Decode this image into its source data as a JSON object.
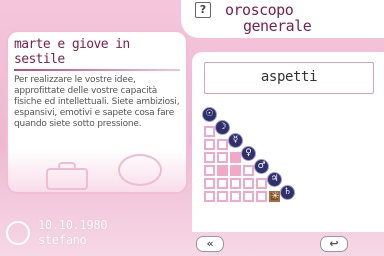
{
  "header": {
    "help_icon": "?",
    "title_line1": "oroscopo",
    "title_line2": "generale"
  },
  "reading": {
    "title": "marte e giove in sestile",
    "body": "Per realizzare le vostre idee, approfittate delle vostre capacità fisiche ed intellettuali. Siete ambiziosi, espansivi, emotivi e sapete cosa fare quando siete sotto pressione."
  },
  "user": {
    "date": "10.10.1980",
    "name": "stefano",
    "icon": "user-icon"
  },
  "aspects": {
    "label": "aspetti",
    "planets": [
      {
        "name": "sun",
        "glyph": "☉"
      },
      {
        "name": "moon",
        "glyph": "☽"
      },
      {
        "name": "mercury",
        "glyph": "☿"
      },
      {
        "name": "venus",
        "glyph": "♀"
      },
      {
        "name": "mars",
        "glyph": "♂"
      },
      {
        "name": "jupiter",
        "glyph": "♃"
      },
      {
        "name": "saturn",
        "glyph": "♄"
      }
    ],
    "marked_aspect_glyph": "✳",
    "colors": {
      "grid_border": "#f0aac9",
      "highlight": "#f3a8c8",
      "aspect_cell": "#7a4a2a",
      "planet_bg": "#2f2f6a"
    }
  },
  "nav": {
    "back_glyph": "«",
    "return_glyph": "↩"
  }
}
